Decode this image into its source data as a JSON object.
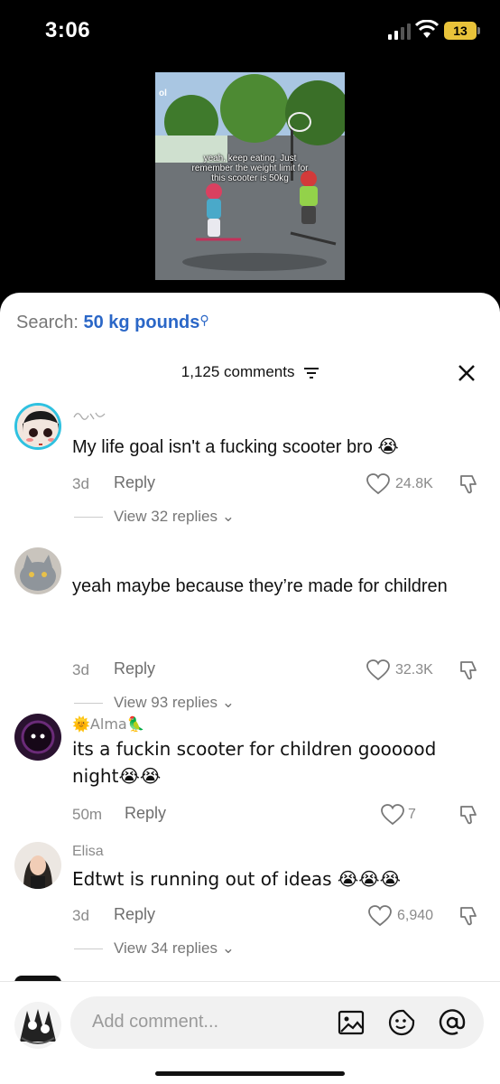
{
  "status_bar": {
    "time": "3:06",
    "battery": "13",
    "icons": [
      "cellular-signal-icon",
      "wifi-icon",
      "battery-icon"
    ]
  },
  "video": {
    "caption": "yeah, keep eating. Just remember the weight limit for this scooter is 50kg",
    "logo": "ol"
  },
  "search": {
    "prefix": "Search: ",
    "query": "50 kg pounds",
    "icon": "search-icon"
  },
  "comments_header": {
    "count_label": "1,125 comments",
    "icons": [
      "filter-icon",
      "close-icon"
    ]
  },
  "comments": [
    {
      "username": "",
      "text": "My life goal isn't a fucking scooter bro 😭",
      "time": "3d",
      "reply_label": "Reply",
      "likes": "24.8K",
      "view_replies": "View 32 replies"
    },
    {
      "username": "",
      "text": "yeah maybe because they’re made for children",
      "time": "3d",
      "reply_label": "Reply",
      "likes": "32.3K",
      "view_replies": "View 93 replies"
    },
    {
      "username": "🌞Alma🦜",
      "text": "its a fuckin scooter for children goooood night😭😭",
      "time": "50m",
      "reply_label": "Reply",
      "likes": "7",
      "view_replies": ""
    },
    {
      "username": "Elisa",
      "text": "Edtwt is running out of ideas 😭😭😭",
      "time": "3d",
      "reply_label": "Reply",
      "likes": "6,940",
      "view_replies": "View 34 replies"
    }
  ],
  "composer": {
    "placeholder": "Add comment...",
    "icons": [
      "image-icon",
      "sticker-icon",
      "mention-icon"
    ]
  },
  "colors": {
    "accent": "#2b67c7",
    "battery": "#e9c33a",
    "avatar_ring": "#2fc1e0"
  }
}
